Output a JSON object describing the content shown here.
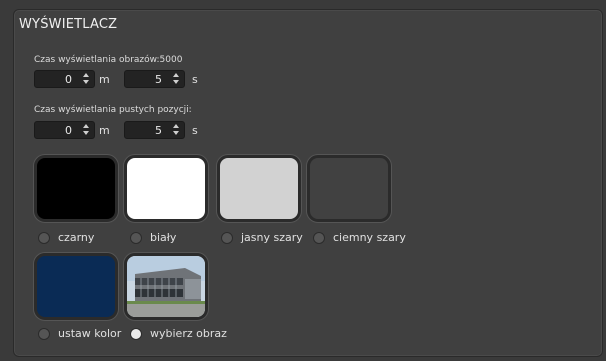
{
  "section": {
    "title": "WYŚWIETLACZ"
  },
  "display_time": {
    "label": "Czas wyświetlania obrazów:5000",
    "minutes": "0",
    "minutes_unit": "m",
    "seconds": "5",
    "seconds_unit": "s"
  },
  "empty_time": {
    "label": "Czas wyświetlania pustych pozycji:",
    "minutes": "0",
    "minutes_unit": "m",
    "seconds": "5",
    "seconds_unit": "s"
  },
  "backgrounds": [
    {
      "label": "czarny",
      "color": "#000000",
      "selected": false
    },
    {
      "label": "biały",
      "color": "#ffffff",
      "selected": false
    },
    {
      "label": "jasny szary",
      "color": "#d2d2d2",
      "selected": false
    },
    {
      "label": "ciemny szary",
      "color": "#414141",
      "selected": false
    }
  ],
  "custom": [
    {
      "label": "ustaw kolor",
      "color": "#0a2b55",
      "selected": false
    },
    {
      "label": "wybierz obraz",
      "icon": "building-photo",
      "selected": true
    }
  ]
}
